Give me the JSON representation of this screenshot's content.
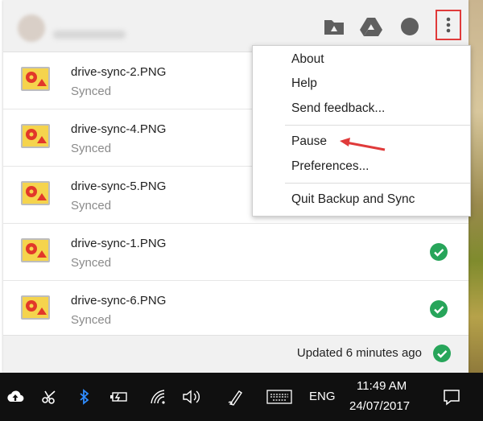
{
  "panel": {
    "files": [
      {
        "name": "drive-sync-2.PNG",
        "status": "Synced",
        "checked": false
      },
      {
        "name": "drive-sync-4.PNG",
        "status": "Synced",
        "checked": false
      },
      {
        "name": "drive-sync-5.PNG",
        "status": "Synced",
        "checked": false
      },
      {
        "name": "drive-sync-1.PNG",
        "status": "Synced",
        "checked": true
      },
      {
        "name": "drive-sync-6.PNG",
        "status": "Synced",
        "checked": true
      }
    ],
    "footer_status": "Updated 6 minutes ago"
  },
  "menu": {
    "about": "About",
    "help": "Help",
    "send_feedback": "Send feedback...",
    "pause": "Pause",
    "preferences": "Preferences...",
    "quit": "Quit Backup and Sync"
  },
  "taskbar": {
    "language": "ENG",
    "time": "11:49 AM",
    "date": "24/07/2017"
  },
  "colors": {
    "accent_check": "#27a55a",
    "highlight_border": "#e03a3a",
    "taskbar_bg": "#101010"
  }
}
